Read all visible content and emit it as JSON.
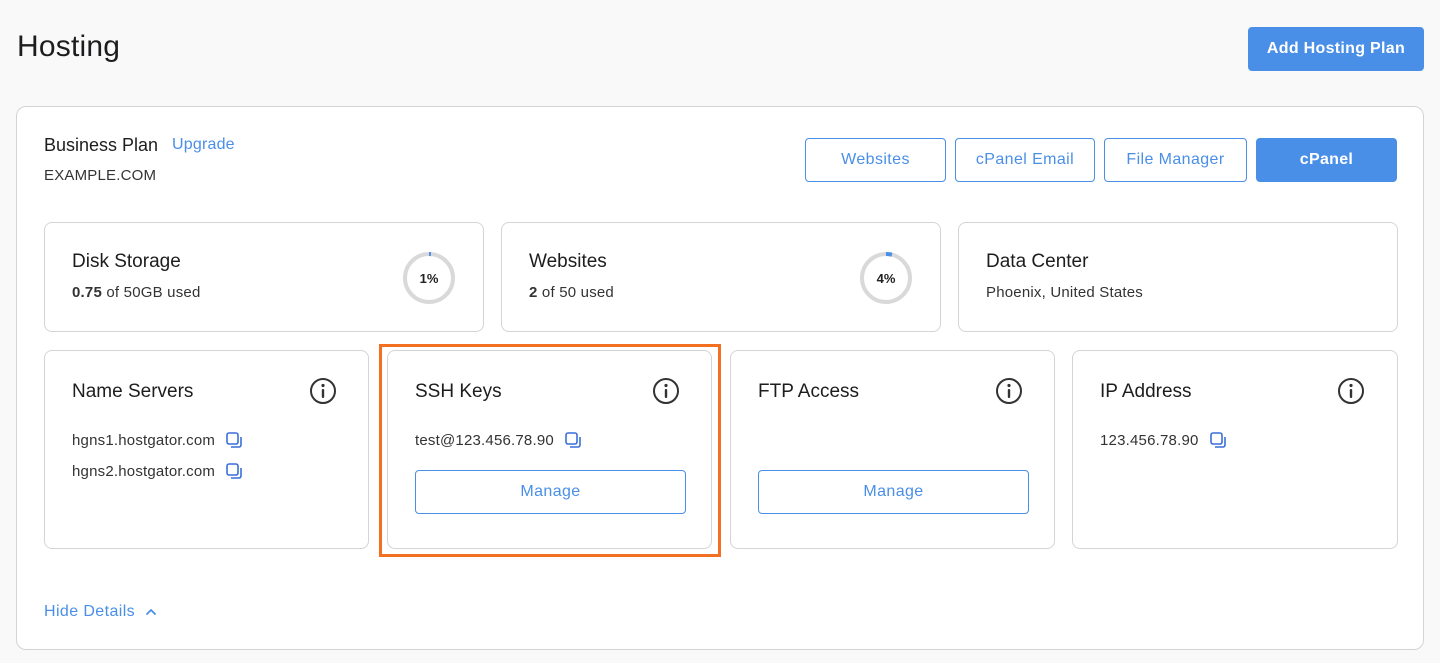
{
  "header": {
    "title": "Hosting",
    "add_button": "Add Hosting Plan"
  },
  "plan": {
    "name": "Business Plan",
    "upgrade": "Upgrade",
    "domain": "EXAMPLE.COM",
    "actions": [
      "Websites",
      "cPanel Email",
      "File Manager",
      "cPanel"
    ]
  },
  "stats": {
    "disk": {
      "title": "Disk Storage",
      "used": "0.75",
      "suffix": "of 50GB used",
      "percent_label": "1%",
      "percent": 1
    },
    "websites": {
      "title": "Websites",
      "used": "2",
      "suffix": "of 50 used",
      "percent_label": "4%",
      "percent": 4
    },
    "datacenter": {
      "title": "Data Center",
      "location": "Phoenix, United States"
    }
  },
  "details": {
    "nameservers": {
      "title": "Name Servers",
      "items": [
        "hgns1.hostgator.com",
        "hgns2.hostgator.com"
      ]
    },
    "ssh": {
      "title": "SSH Keys",
      "key": "test@123.456.78.90",
      "button": "Manage"
    },
    "ftp": {
      "title": "FTP Access",
      "button": "Manage"
    },
    "ip": {
      "title": "IP Address",
      "value": "123.456.78.90"
    }
  },
  "footer": {
    "hide_details": "Hide Details"
  },
  "colors": {
    "accent": "#4a8fe7",
    "highlight": "#f36f21",
    "border": "#d4d4d4",
    "gauge_track": "#d9d9d9"
  }
}
